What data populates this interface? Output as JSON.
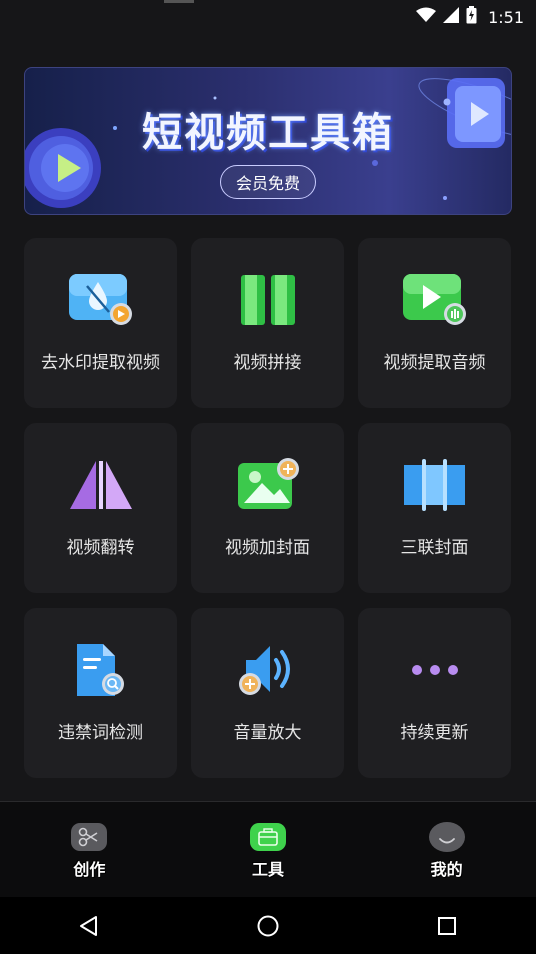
{
  "status_bar": {
    "time": "1:51",
    "icons": [
      "wifi-icon",
      "signal-icon",
      "battery-icon"
    ]
  },
  "banner": {
    "title": "短视频工具箱",
    "button_label": "会员免费"
  },
  "tools": [
    {
      "label": "去水印提取视频",
      "icon": "watermark-removal-icon"
    },
    {
      "label": "视频拼接",
      "icon": "video-splice-icon"
    },
    {
      "label": "视频提取音频",
      "icon": "video-extract-audio-icon"
    },
    {
      "label": "视频翻转",
      "icon": "video-flip-icon"
    },
    {
      "label": "视频加封面",
      "icon": "add-cover-icon"
    },
    {
      "label": "三联封面",
      "icon": "triple-cover-icon"
    },
    {
      "label": "违禁词检测",
      "icon": "banned-word-check-icon"
    },
    {
      "label": "音量放大",
      "icon": "volume-amplify-icon"
    },
    {
      "label": "持续更新",
      "icon": "more-dots-icon"
    }
  ],
  "tab_bar": {
    "tabs": [
      {
        "label": "创作",
        "icon": "scissors-icon",
        "active": false
      },
      {
        "label": "工具",
        "icon": "toolbox-icon",
        "active": true
      },
      {
        "label": "我的",
        "icon": "smile-icon",
        "active": false
      }
    ]
  },
  "nav_bar": {
    "buttons": [
      "back-triangle-icon",
      "home-circle-icon",
      "recents-square-icon"
    ]
  },
  "colors": {
    "background": "#161618",
    "card": "#1f1f22",
    "accent_green": "#3fd24c",
    "accent_blue": "#3a9df0",
    "accent_purple": "#b06be8"
  }
}
